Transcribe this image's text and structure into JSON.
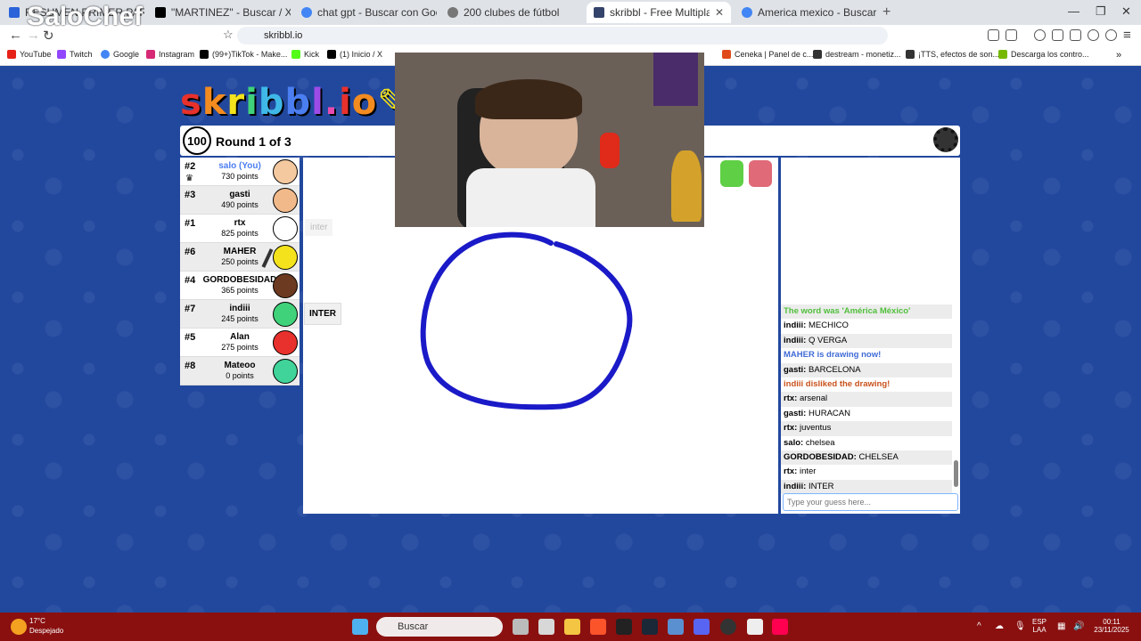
{
  "browser": {
    "tabs": [
      {
        "label": "RESUMEN PRIMER PARCIAL",
        "color": "#2b63d9"
      },
      {
        "label": "\"MARTINEZ\" - Buscar / X",
        "color": "#000000"
      },
      {
        "label": "chat gpt - Buscar con Google",
        "color": "#4285f4"
      },
      {
        "label": "200 clubes de fútbol",
        "color": "#555555"
      },
      {
        "label": "skribbl - Free Multiplayer Drawin",
        "color": "#33436b"
      },
      {
        "label": "America mexico - Buscar con Google",
        "color": "#4285f4"
      }
    ],
    "active_tab_close": "✕",
    "new_tab": "+",
    "address": "skribbl.io",
    "bookmarks": [
      {
        "label": "YouTube",
        "color": "#e62117"
      },
      {
        "label": "Twitch",
        "color": "#9146ff"
      },
      {
        "label": "Google",
        "color": "#4285f4"
      },
      {
        "label": "Instagram",
        "color": "#d62976"
      },
      {
        "label": "(99+)TikTok - Make...",
        "color": "#000000"
      },
      {
        "label": "Kick",
        "color": "#53fc18"
      },
      {
        "label": "(1) Inicio / X",
        "color": "#000000"
      },
      {
        "label": "Ceneka | Panel de c...",
        "color": "#e04a1a"
      },
      {
        "label": "destream - monetiz...",
        "color": "#333333"
      },
      {
        "label": "¡TTS, efectos de son...",
        "color": "#333333"
      },
      {
        "label": "Descarga los contro...",
        "color": "#76b900"
      }
    ]
  },
  "watermark": "SaloChef",
  "game": {
    "timer": "100",
    "round": "Round 1 of 3",
    "players": [
      {
        "rank": "#2",
        "name": "salo (You)",
        "points": "730 points",
        "avatar": "#f4c9a0",
        "you": true
      },
      {
        "rank": "#3",
        "name": "gasti",
        "points": "490 points",
        "avatar": "#f1b98a",
        "you": false
      },
      {
        "rank": "#1",
        "name": "rtx",
        "points": "825 points",
        "avatar": "#ffffff",
        "you": false
      },
      {
        "rank": "#6",
        "name": "MAHER",
        "points": "250 points",
        "avatar": "#f3e21c",
        "you": false
      },
      {
        "rank": "#4",
        "name": "GORDOBESIDAD",
        "points": "365 points",
        "avatar": "#6b3a20",
        "you": false
      },
      {
        "rank": "#7",
        "name": "indiii",
        "points": "245 points",
        "avatar": "#3fd27a",
        "you": false
      },
      {
        "rank": "#5",
        "name": "Alan",
        "points": "275 points",
        "avatar": "#e8312c",
        "you": false
      },
      {
        "rank": "#8",
        "name": "Mateoo",
        "points": "0 points",
        "avatar": "#40d39a",
        "you": false
      }
    ],
    "guess_bubble": "inter",
    "inter_bubble": "INTER",
    "chat": [
      {
        "text": "The word was 'América México'",
        "color": "#4fbf3a",
        "bold": true,
        "alt": true
      },
      {
        "name": "indiii:",
        "text": "MECHICO",
        "alt": false
      },
      {
        "name": "indiii:",
        "text": "Q VERGA",
        "alt": true
      },
      {
        "text": "MAHER is drawing now!",
        "color": "#3f6bd6",
        "bold": true,
        "alt": false
      },
      {
        "name": "gasti:",
        "text": "BARCELONA",
        "alt": true
      },
      {
        "text": "indiii disliked the drawing!",
        "color": "#c9521c",
        "bold": true,
        "alt": false
      },
      {
        "name": "rtx:",
        "text": "arsenal",
        "alt": true
      },
      {
        "name": "gasti:",
        "text": "HURACAN",
        "alt": false
      },
      {
        "name": "rtx:",
        "text": "juventus",
        "alt": true
      },
      {
        "name": "salo:",
        "text": "chelsea",
        "alt": false
      },
      {
        "name": "GORDOBESIDAD:",
        "text": "CHELSEA",
        "alt": true
      },
      {
        "name": "rtx:",
        "text": "inter",
        "alt": false
      },
      {
        "name": "indiii:",
        "text": "INTER",
        "alt": true
      }
    ],
    "guess_placeholder": "Type your guess here...",
    "stroke_color": "#1a1ac8"
  },
  "taskbar": {
    "weather_temp": "17°C",
    "weather_desc": "Despejado",
    "search": "Buscar",
    "lang1": "ESP",
    "lang2": "LAA",
    "time": "00:11",
    "date": "23/11/2025"
  }
}
